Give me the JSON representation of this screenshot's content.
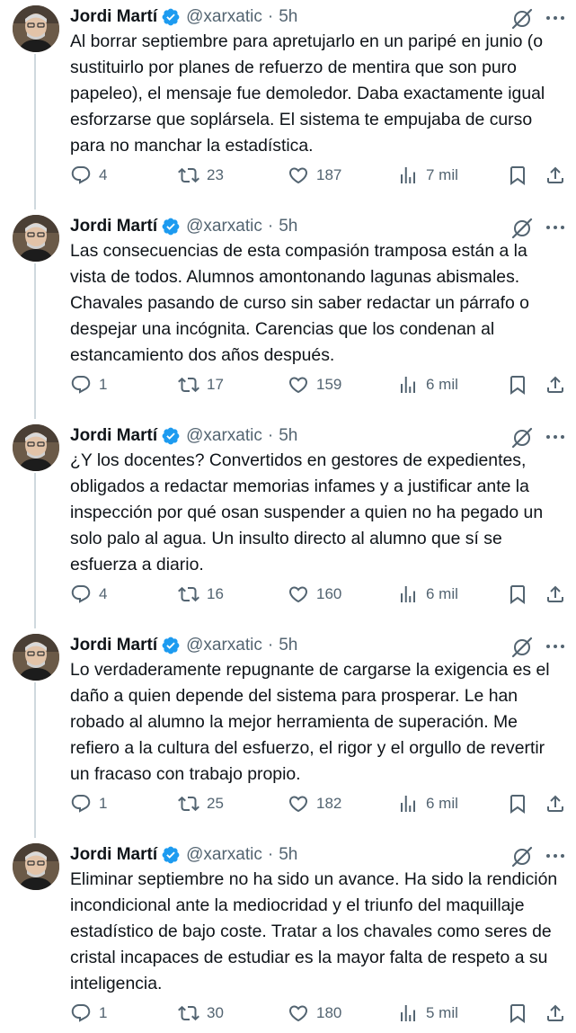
{
  "colors": {
    "text": "#0f1419",
    "muted": "#536471",
    "verified": "#1d9bf0",
    "thread_line": "#cfd9de"
  },
  "icons": [
    "verified-badge-icon",
    "grok-icon",
    "more-icon",
    "reply-icon",
    "retweet-icon",
    "like-icon",
    "views-icon",
    "bookmark-icon",
    "share-icon"
  ],
  "tweets": [
    {
      "author": "Jordi Martí",
      "handle": "@xarxatic",
      "dot": "·",
      "time": "5h",
      "text": "Al borrar septiembre para apretujarlo en un paripé en junio (o sustituirlo por planes de refuerzo de mentira que son puro papeleo), el mensaje fue demoledor. Daba exactamente igual esforzarse que soplársela. El sistema te empujaba de curso para no manchar la estadística.",
      "replies": "4",
      "retweets": "23",
      "likes": "187",
      "views": "7 mil"
    },
    {
      "author": "Jordi Martí",
      "handle": "@xarxatic",
      "dot": "·",
      "time": "5h",
      "text": "Las consecuencias de esta compasión tramposa están a la vista de todos. Alumnos amontonando lagunas abismales. Chavales pasando de curso sin saber redactar un párrafo o despejar una incógnita. Carencias que los condenan al estancamiento dos años después.",
      "replies": "1",
      "retweets": "17",
      "likes": "159",
      "views": "6 mil"
    },
    {
      "author": "Jordi Martí",
      "handle": "@xarxatic",
      "dot": "·",
      "time": "5h",
      "text": "¿Y los docentes? Convertidos en gestores de expedientes, obligados a redactar memorias infames y a justificar ante la inspección por qué osan suspender a quien no ha pegado un solo palo al agua. Un insulto directo al alumno que sí se esfuerza a diario.",
      "replies": "4",
      "retweets": "16",
      "likes": "160",
      "views": "6 mil"
    },
    {
      "author": "Jordi Martí",
      "handle": "@xarxatic",
      "dot": "·",
      "time": "5h",
      "text": "Lo verdaderamente repugnante de cargarse la exigencia es el daño a quien depende del sistema para prosperar. Le han robado al alumno la mejor herramienta de superación. Me refiero a la cultura del esfuerzo, el rigor y el orgullo de revertir un fracaso con trabajo propio.",
      "replies": "1",
      "retweets": "25",
      "likes": "182",
      "views": "6 mil"
    },
    {
      "author": "Jordi Martí",
      "handle": "@xarxatic",
      "dot": "·",
      "time": "5h",
      "text": "Eliminar septiembre no ha sido un avance. Ha sido la rendición incondicional ante la mediocridad y el triunfo del maquillaje estadístico de bajo coste. Tratar a los chavales como seres de cristal incapaces de estudiar es la mayor falta de respeto a su inteligencia.",
      "replies": "1",
      "retweets": "30",
      "likes": "180",
      "views": "5 mil"
    }
  ]
}
